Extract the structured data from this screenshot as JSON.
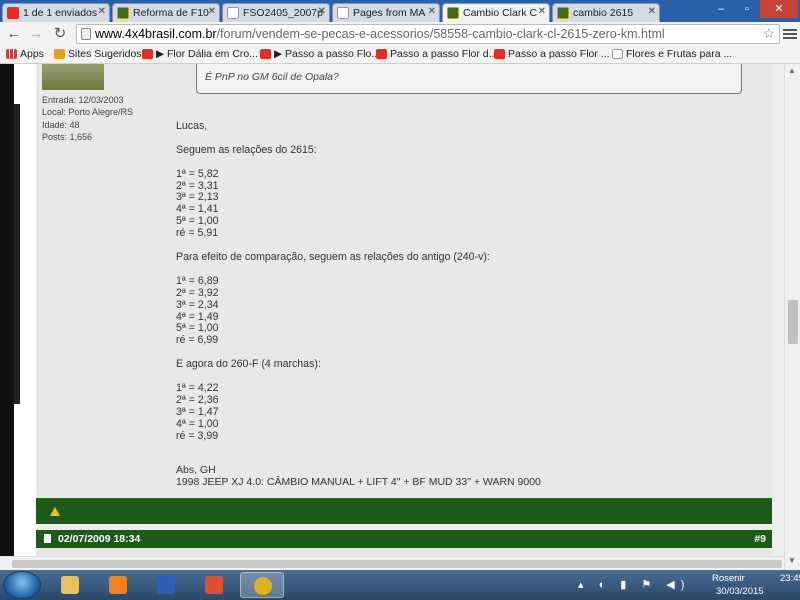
{
  "browser": {
    "tabs": [
      {
        "title": "1 de 1 enviados",
        "favicon": "youtube-icon",
        "active": false
      },
      {
        "title": "Reforma de F10",
        "favicon": "forum-favicon",
        "active": false
      },
      {
        "title": "FSO2405_2007p",
        "favicon": "document-icon",
        "active": false
      },
      {
        "title": "Pages from MA",
        "favicon": "document-icon",
        "active": false
      },
      {
        "title": "Cambio Clark C",
        "favicon": "forum-favicon",
        "active": true
      },
      {
        "title": "cambio 2615",
        "favicon": "forum-favicon",
        "active": false
      }
    ],
    "url_host": "www.4x4brasil.com.br",
    "url_path": "/forum/vendem-se-pecas-e-acessorios/58558-cambio-clark-cl-2615-zero-km.html",
    "bookmarks": [
      {
        "label": "Apps",
        "icon": "apps-icon"
      },
      {
        "label": "Sites Sugeridos",
        "icon": "suggested-sites-icon"
      },
      {
        "label": "▶ Flor Dália em Cro...",
        "icon": "youtube-icon"
      },
      {
        "label": "▶ Passo a passo Flo...",
        "icon": "youtube-icon"
      },
      {
        "label": "Passo a passo Flor d...",
        "icon": "youtube-icon"
      },
      {
        "label": "Passo a passo Flor ...",
        "icon": "youtube-icon"
      },
      {
        "label": "Flores e Frutas para ...",
        "icon": "document-icon"
      }
    ]
  },
  "post": {
    "user_info": {
      "entrada": "Entrada: 12/03/2003",
      "local": "Local: Porto Alegre/RS",
      "idade": "Idade: 48",
      "posts": "Posts: 1,656"
    },
    "quote_text": "É PnP no GM 6cil de Opala?",
    "body_lines": [
      "Lucas,",
      "",
      "Seguem as relações do 2615:",
      "",
      "1ª = 5,82",
      "2ª = 3,31",
      "3ª = 2,13",
      "4ª = 1,41",
      "5ª = 1,00",
      "ré = 5,91",
      "",
      "Para efeito de comparação, seguem as relações do antigo (240-v):",
      "",
      "1ª = 6,89",
      "2ª = 3,92",
      "3ª = 2,34",
      "4ª = 1,49",
      "5ª = 1,00",
      "ré = 6,99",
      "",
      "E agora do 260-F (4 marchas):",
      "",
      "1ª = 4,22",
      "2ª = 2,36",
      "3ª = 1,47",
      "4ª = 1,00",
      "ré = 3,99"
    ],
    "signature_greeting": "Abs, GH",
    "signature_vehicle": "1998 JEEP XJ 4.0: CÂMBIO MANUAL + LIFT 4\" + BF MUD 33\" + WARN 9000"
  },
  "next_post": {
    "date": "02/07/2009 18:34",
    "number": "#9"
  },
  "taskbar": {
    "items": [
      {
        "name": "file-explorer-icon",
        "color": "#e8c060"
      },
      {
        "name": "media-player-icon",
        "color": "#f08020"
      },
      {
        "name": "word-icon",
        "color": "#2b5fb3"
      },
      {
        "name": "presentation-icon",
        "color": "#e05030"
      },
      {
        "name": "chrome-icon",
        "color": "#e0b020"
      }
    ],
    "user": "Rosenir",
    "time": "23:49",
    "date": "30/03/2015"
  },
  "colors": {
    "forum_green": "#1e5a1a",
    "warning_yellow": "#f2c11b"
  }
}
